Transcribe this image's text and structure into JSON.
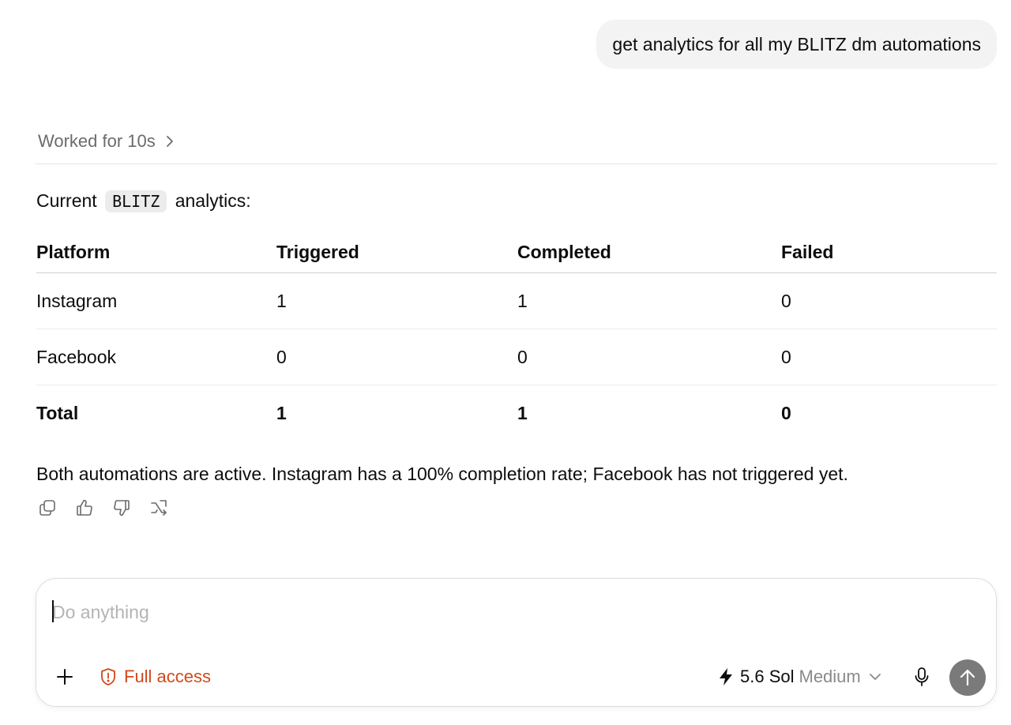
{
  "user_message": "get analytics for all my BLITZ dm automations",
  "worked": {
    "label": "Worked for 10s",
    "icon": "chevron-right-icon"
  },
  "intro": {
    "before": "Current",
    "code": "BLITZ",
    "after": "analytics:"
  },
  "table": {
    "headers": [
      "Platform",
      "Triggered",
      "Completed",
      "Failed"
    ],
    "rows": [
      [
        "Instagram",
        "1",
        "1",
        "0"
      ],
      [
        "Facebook",
        "0",
        "0",
        "0"
      ]
    ],
    "total": [
      "Total",
      "1",
      "1",
      "0"
    ]
  },
  "summary": "Both automations are active. Instagram has a 100% completion rate; Facebook has not triggered yet.",
  "message_actions": [
    "copy-icon",
    "thumbs-up-icon",
    "thumbs-down-icon",
    "share-icon"
  ],
  "composer": {
    "placeholder": "Do anything",
    "value": "",
    "access_label": "Full access",
    "access_color": "#d0491a",
    "model_name": "5.6 Sol",
    "model_level": "Medium",
    "send_color": "#7a7a7a"
  }
}
